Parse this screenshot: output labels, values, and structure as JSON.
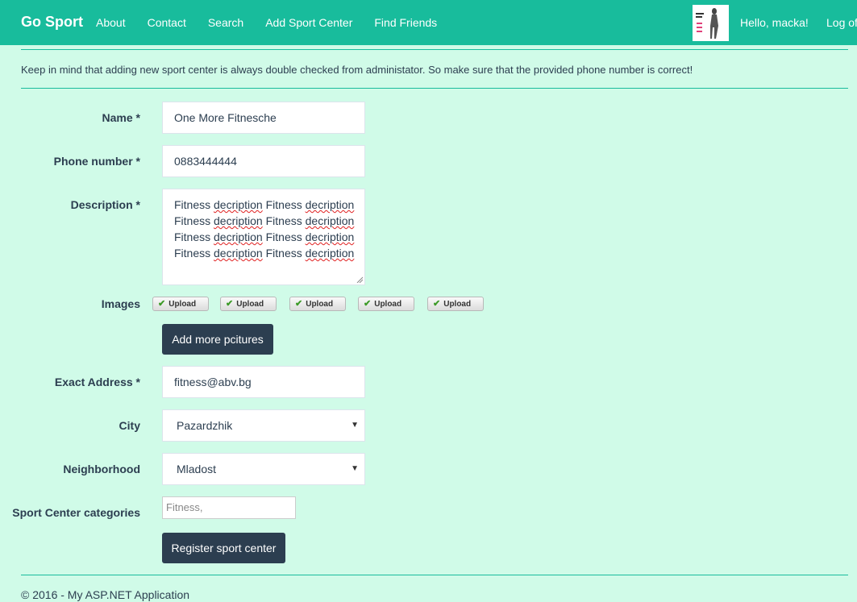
{
  "navbar": {
    "brand": "Go Sport",
    "links": [
      "About",
      "Contact",
      "Search",
      "Add Sport Center",
      "Find Friends"
    ],
    "greeting": "Hello, macka!",
    "logoff": "Log off"
  },
  "notice": "Keep in mind that adding new sport center is always double checked from administator. So make sure that the provided phone number is correct!",
  "form": {
    "name_label": "Name *",
    "name_value": "One More Fitnesche",
    "phone_label": "Phone number *",
    "phone_value": "0883444444",
    "description_label": "Description *",
    "description_lines": [
      [
        "Fitness ",
        "decription",
        " Fitness ",
        "decription"
      ],
      [
        "Fitness ",
        "decription",
        " Fitness ",
        "decription"
      ],
      [
        "Fitness ",
        "decription",
        " Fitness ",
        "decription"
      ],
      [
        "Fitness ",
        "decription",
        " Fitness ",
        "decription"
      ]
    ],
    "images_label": "Images",
    "upload_label": "Upload",
    "add_pictures": "Add more pcitures",
    "address_label": "Exact Address *",
    "address_value": "fitness@abv.bg",
    "city_label": "City",
    "city_value": "Pazardzhik",
    "neighborhood_label": "Neighborhood",
    "neighborhood_value": "Mladost",
    "categories_label": "Sport Center categories",
    "categories_placeholder": "Fitness,",
    "submit": "Register sport center"
  },
  "footer": "© 2016 - My ASP.NET Application",
  "colors": {
    "navbar": "#18bc9c",
    "background": "#d0fbe8",
    "button": "#2c3e50"
  }
}
